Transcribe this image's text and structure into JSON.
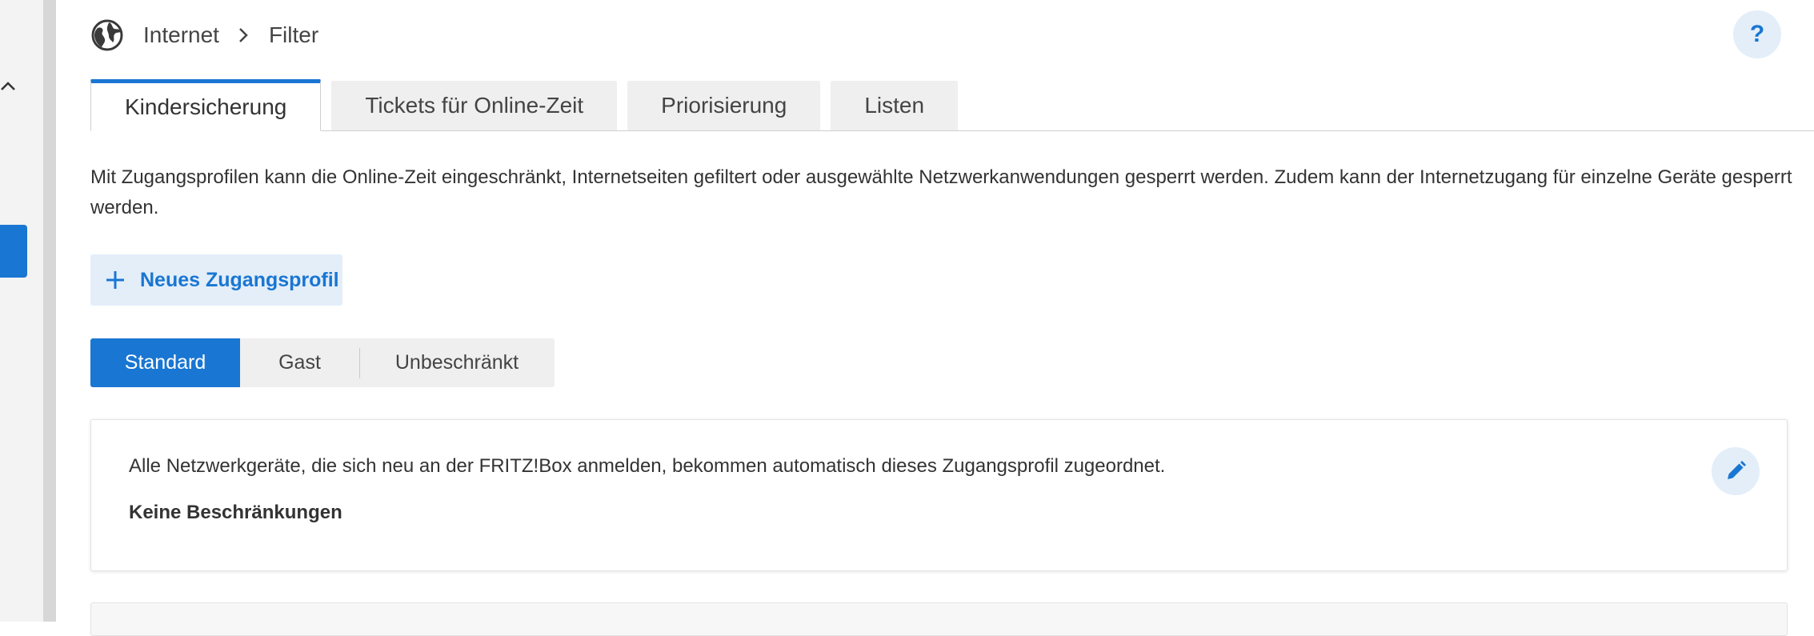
{
  "breadcrumb": {
    "section": "Internet",
    "page": "Filter"
  },
  "help": {
    "label": "?"
  },
  "tabs": [
    {
      "label": "Kindersicherung",
      "active": true
    },
    {
      "label": "Tickets für Online-Zeit",
      "active": false
    },
    {
      "label": "Priorisierung",
      "active": false
    },
    {
      "label": "Listen",
      "active": false
    }
  ],
  "description": "Mit Zugangsprofilen kann die Online-Zeit eingeschränkt, Internetseiten gefiltert oder ausgewählte Netzwerkanwendungen gesperrt werden. Zudem kann der Internetzugang für einzelne Geräte gesperrt werden.",
  "add_profile": {
    "label": "Neues Zugangsprofil"
  },
  "profiles": [
    {
      "label": "Standard",
      "active": true
    },
    {
      "label": "Gast",
      "active": false
    },
    {
      "label": "Unbeschränkt",
      "active": false
    }
  ],
  "profile_card": {
    "text": "Alle Netzwerkgeräte, die sich neu an der FRITZ!Box anmelden, bekommen automatisch dieses Zugangsprofil zugeordnet.",
    "status": "Keine Beschränkungen"
  },
  "icons": {
    "globe": "globe-icon",
    "chevron": "chevron-right-icon",
    "collapse": "chevron-up-icon",
    "plus": "plus-icon",
    "edit": "pencil-icon"
  },
  "colors": {
    "accent": "#1976d2",
    "accent_light": "#e3eef9",
    "tab_inactive": "#efefef",
    "sidebar": "#f3f3f3"
  }
}
